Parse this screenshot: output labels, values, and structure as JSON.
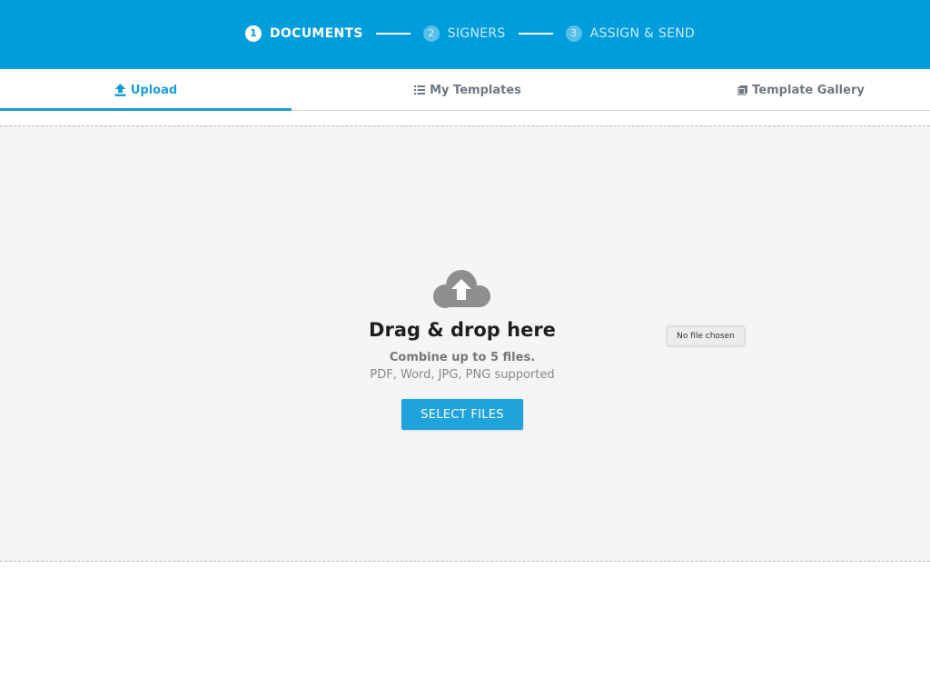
{
  "stepper": {
    "steps": [
      {
        "number": "1",
        "label": "DOCUMENTS",
        "state": "active"
      },
      {
        "number": "2",
        "label": "SIGNERS",
        "state": "inactive"
      },
      {
        "number": "3",
        "label": "ASSIGN & SEND",
        "state": "inactive"
      }
    ]
  },
  "tabs": [
    {
      "label": "Upload",
      "icon": "upload-arrow-icon",
      "active": true
    },
    {
      "label": "My Templates",
      "icon": "list-icon",
      "active": false
    },
    {
      "label": "Template Gallery",
      "icon": "gallery-icon",
      "active": false
    }
  ],
  "dropzone": {
    "icon": "cloud-upload-icon",
    "title": "Drag & drop here",
    "subtitle": "Combine up to 5 files.",
    "formats": "PDF, Word, JPG, PNG supported",
    "button_label": "SELECT FILES",
    "file_status": "No file chosen"
  },
  "colors": {
    "header_bg": "#009ddc",
    "accent": "#1a9ed8",
    "dropzone_bg": "#f5f5f5"
  }
}
